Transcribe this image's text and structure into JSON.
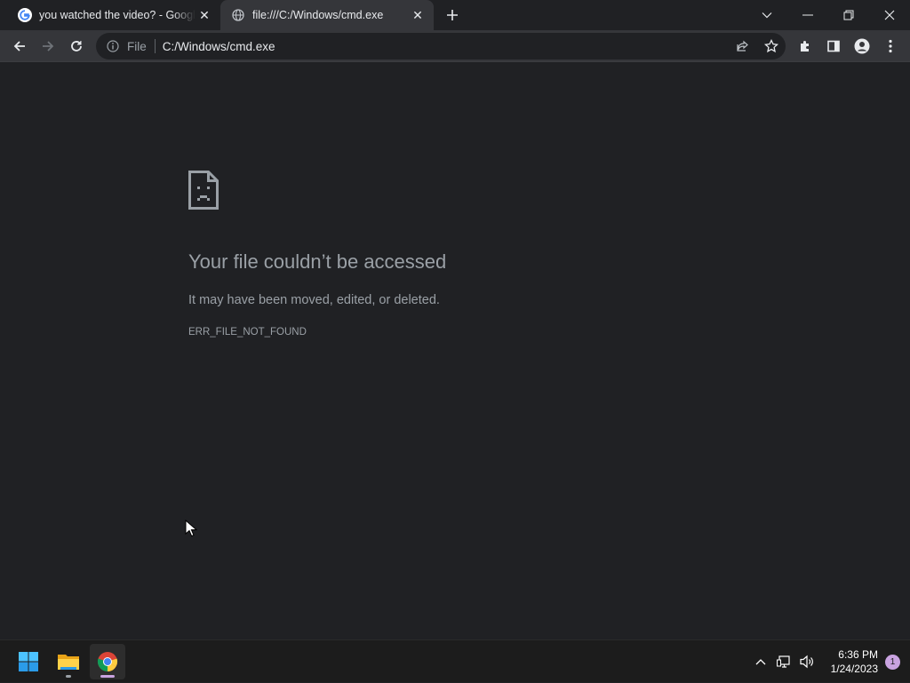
{
  "browser": {
    "tabs": [
      {
        "title": "you watched the video? - Google Search",
        "favicon": "google-icon",
        "active": false
      },
      {
        "title": "file:///C:/Windows/cmd.exe",
        "favicon": "globe-icon",
        "active": true
      }
    ],
    "address_bar": {
      "scheme_chip": "File",
      "url": "C:/Windows/cmd.exe"
    }
  },
  "error_page": {
    "icon": "sad-file-icon",
    "title": "Your file couldn’t be accessed",
    "description": "It may have been moved, edited, or deleted.",
    "code": "ERR_FILE_NOT_FOUND"
  },
  "taskbar": {
    "apps": [
      {
        "name": "start-icon"
      },
      {
        "name": "file-explorer-icon"
      },
      {
        "name": "chrome-icon"
      }
    ],
    "clock": {
      "time": "6:36 PM",
      "date": "1/24/2023"
    },
    "notification_count": "1"
  },
  "colors": {
    "background": "#202124",
    "toolbar": "#35363a",
    "text_secondary": "#9aa0a6",
    "taskbar": "#1c1c1c"
  }
}
